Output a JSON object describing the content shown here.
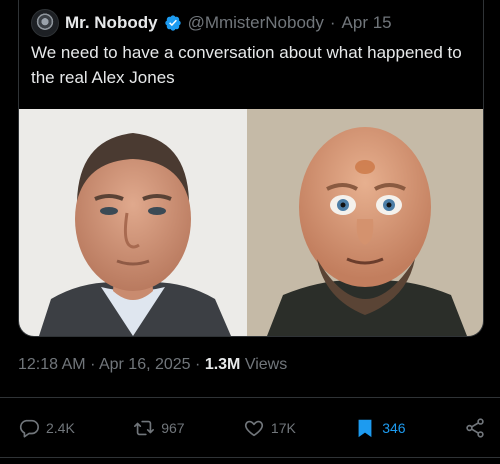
{
  "quoted_tweet": {
    "display_name": "Mr. Nobody",
    "handle": "@MmisterNobody",
    "separator": "·",
    "date": "Apr 15",
    "text": "We need to have a conversation about what happened to the real Alex Jones"
  },
  "tweet_meta": {
    "time": "12:18 AM",
    "date": "Apr 16, 2025",
    "separator": "·",
    "views": "1.3M",
    "views_label": "Views"
  },
  "actions": {
    "reply_count": "2.4K",
    "retweet_count": "967",
    "like_count": "17K",
    "bookmark_count": "346"
  },
  "colors": {
    "background": "#000000",
    "text": "#e7e9ea",
    "muted": "#71767b",
    "accent": "#1d9bf0",
    "border": "#2f3336"
  },
  "icons": [
    "verified-badge-icon",
    "reply-icon",
    "retweet-icon",
    "like-icon",
    "bookmark-icon",
    "share-icon"
  ]
}
